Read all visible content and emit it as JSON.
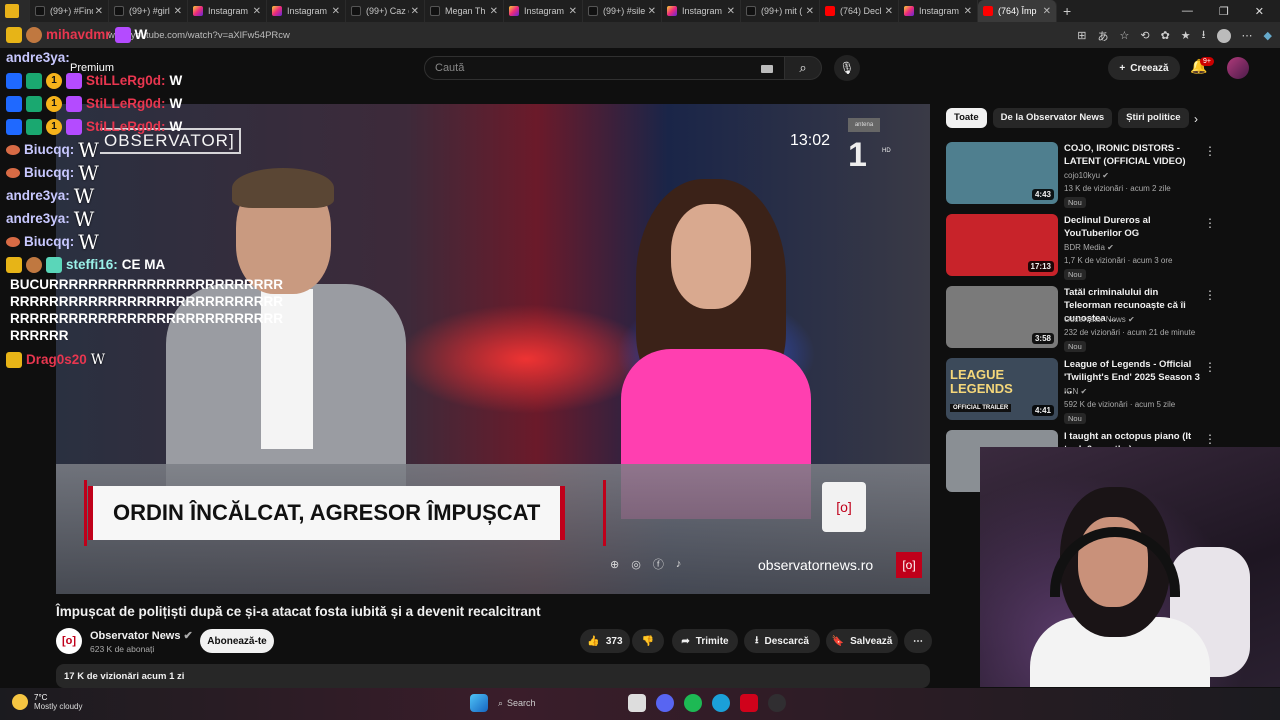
{
  "browser": {
    "tabs": [
      {
        "label": "(99+) #Findi",
        "icon": "tiktok-icon",
        "kind": "tt"
      },
      {
        "label": "(99+) #girl",
        "icon": "tiktok-icon",
        "kind": "tt"
      },
      {
        "label": "Instagram",
        "icon": "instagram-icon",
        "kind": "ig"
      },
      {
        "label": "Instagram",
        "icon": "instagram-icon",
        "kind": "ig"
      },
      {
        "label": "(99+) Caz d",
        "icon": "tiktok-icon",
        "kind": "tt"
      },
      {
        "label": "Megan Th",
        "icon": "tiktok-icon",
        "kind": "tt"
      },
      {
        "label": "Instagram",
        "icon": "instagram-icon",
        "kind": "ig"
      },
      {
        "label": "(99+) #sile",
        "icon": "tiktok-icon",
        "kind": "tt"
      },
      {
        "label": "Instagram",
        "icon": "instagram-icon",
        "kind": "ig"
      },
      {
        "label": "(99+) mit (",
        "icon": "tiktok-icon",
        "kind": "tt"
      },
      {
        "label": "(764) Decl",
        "icon": "youtube-icon",
        "kind": "yt"
      },
      {
        "label": "Instagram",
        "icon": "instagram-icon",
        "kind": "ig"
      },
      {
        "label": "(764) Împ",
        "icon": "youtube-icon",
        "kind": "yt",
        "active": true
      }
    ],
    "url": "www.youtube.com/watch?v=aXlFw54PRcw"
  },
  "youtube": {
    "premium": "Premium",
    "search_placeholder": "Caută",
    "create_label": "Creează",
    "notif_badge": "9+",
    "video": {
      "channel_logo": "OBSERVATOR]",
      "clock": "13:02",
      "network_label": "antena",
      "network_mark": "1",
      "hd": "HD",
      "banner": "ORDIN ÎNCĂLCAT, AGRESOR ÎMPUȘCAT",
      "site": "observatornews.ro",
      "mug_logo": "[o]"
    },
    "title": "Împușcat de polițiști după ce și-a atacat fosta iubită și a devenit recalcitrant",
    "channel": {
      "name": "Observator News",
      "subs": "623 K de abonați",
      "logo": "[o]"
    },
    "subscribe_label": "Abonează-te",
    "actions": {
      "likes": "373",
      "share": "Trimite",
      "download": "Descarcă",
      "save": "Salvează"
    },
    "description": "17 K de vizionări  acum 1 zi",
    "chips": [
      "Toate",
      "De la Observator News",
      "Știri politice"
    ],
    "recommendations": [
      {
        "title": "COJO, IRONIC DISTORS - LATENT (OFFICIAL VIDEO)",
        "channel": "cojo10kyu",
        "meta": "13 K de vizionări · acum 2 zile",
        "duration": "4:43",
        "new": "Nou",
        "color": "#4f7f8f"
      },
      {
        "title": "Declinul Dureros al YouTuberilor OG",
        "channel": "BDR Media",
        "meta": "1,7 K de vizionări · acum 3 ore",
        "duration": "17:13",
        "new": "Nou",
        "color": "#c8232a"
      },
      {
        "title": "Tatăl criminalului din Teleorman recunoaște că îi cunoștea ...",
        "channel": "Observator News",
        "meta": "232 de vizionări · acum 21 de minute",
        "duration": "3:58",
        "new": "Nou",
        "color": "#7a7a7a"
      },
      {
        "title": "League of Legends - Official 'Twilight's End' 2025 Season 3 ...",
        "channel": "IGN",
        "meta": "592 K de vizionări · acum 5 zile",
        "duration": "4:41",
        "new": "Nou",
        "color": "#3c4a5a"
      },
      {
        "title": "I taught an octopus piano (It took 6 months)",
        "channel": "",
        "meta": "",
        "duration": "",
        "new": "",
        "color": "#8a8f94"
      }
    ],
    "rec4_thumb_text": "LEAGUE LEGENDS",
    "rec4_thumb_tag": "OFFICIAL TRAILER"
  },
  "chat": [
    {
      "user": "mihavdmr",
      "msg": "W",
      "color": "red"
    },
    {
      "user": "andre3ya:",
      "msg": "",
      "color": "blue"
    },
    {
      "user": "StiLLeRg0d:",
      "msg": "W",
      "color": "red"
    },
    {
      "user": "StiLLeRg0d:",
      "msg": "W",
      "color": "red"
    },
    {
      "user": "StiLLeRg0d:",
      "msg": "W",
      "color": "red"
    },
    {
      "user": "Biucqq:",
      "msg": "W",
      "color": "blue"
    },
    {
      "user": "Biucqq:",
      "msg": "W",
      "color": "blue"
    },
    {
      "user": "andre3ya:",
      "msg": "W",
      "color": "blue"
    },
    {
      "user": "andre3ya:",
      "msg": "W",
      "color": "blue"
    },
    {
      "user": "Biucqq:",
      "msg": "W",
      "color": "blue"
    },
    {
      "user": "steffi16:",
      "msg": "CE MA",
      "color": "teal"
    },
    {
      "user": "Drag0s20",
      "msg": "W",
      "color": "red"
    }
  ],
  "chat_long": "BUCURRRRRRRRRRRRRRRRRRRRRRRRRRRRRRRRRRRRRRRRRRRRRRRRRRRRRRRRRRRRRRRRRRRRRRRRRRRRRRRRRRRRRR",
  "taskbar": {
    "temp": "7°C",
    "weather": "Mostly cloudy",
    "search": "Search"
  }
}
